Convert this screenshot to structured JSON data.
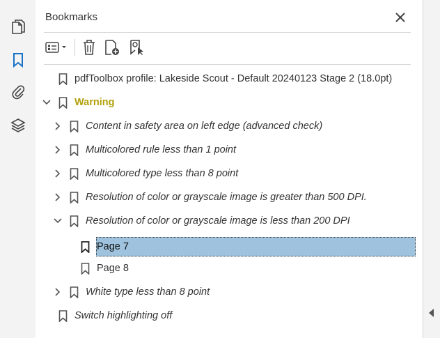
{
  "panel": {
    "title": "Bookmarks",
    "close_icon": "close-icon"
  },
  "rail": {
    "items": [
      {
        "name": "pages-icon"
      },
      {
        "name": "bookmarks-icon",
        "active": true
      },
      {
        "name": "attachments-icon"
      },
      {
        "name": "layers-icon"
      }
    ]
  },
  "toolbar": {
    "options_icon": "list-options-icon",
    "delete_icon": "trash-icon",
    "new_bookmark_icon": "add-bookmark-icon",
    "new_from_structure_icon": "bookmark-from-selection-icon"
  },
  "bookmarks": {
    "profile": "pdfToolbox profile: Lakeside Scout - Default 20240123 Stage 2 (18.0pt)",
    "warning": "Warning",
    "items": [
      "Content in safety area on left edge (advanced check)",
      "Multicolored rule less than 1 point",
      "Multicolored type less than 8 point",
      "Resolution of color or grayscale image is greater than 500 DPI.",
      "Resolution of color or grayscale image is less than 200 DPI"
    ],
    "pages": [
      "Page 7",
      "Page 8"
    ],
    "white_type": "White type less than 8 point",
    "switch": "Switch highlighting off"
  },
  "colors": {
    "accent": "#2b6cb0",
    "warning": "#b2a10a",
    "selection": "#9fc3de"
  }
}
